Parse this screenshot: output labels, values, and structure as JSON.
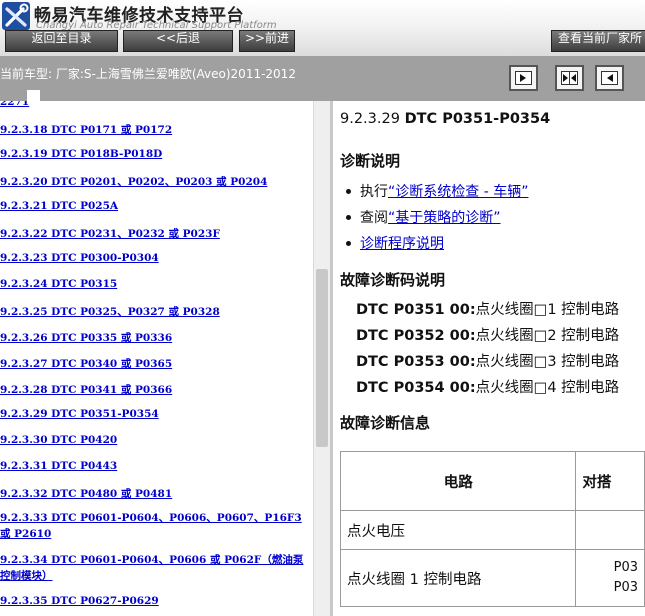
{
  "header": {
    "title": "畅易汽车维修技术支持平台",
    "subtitle": "Changyi Auto Repair Technical Support Platform",
    "buttons": {
      "back": "返回至目录",
      "prev": "<<后退",
      "next": ">>前进",
      "view": "查看当前厂家所"
    }
  },
  "vehicle_bar": {
    "label": "当前车型:   厂家:S-上海雪佛兰爱唯欧(Aveo)2011-2012"
  },
  "toc": {
    "partial_top": "2271",
    "items": [
      "9.2.3.18 DTC P0171 或 P0172",
      "9.2.3.19 DTC P018B-P018D",
      "9.2.3.20 DTC P0201、P0202、P0203 或 P0204",
      "9.2.3.21 DTC P025A",
      "9.2.3.22 DTC P0231、P0232 或 P023F",
      "9.2.3.23 DTC P0300-P0304",
      "9.2.3.24 DTC P0315",
      "9.2.3.25 DTC P0325、P0327 或 P0328",
      "9.2.3.26 DTC P0335 或 P0336",
      "9.2.3.27 DTC P0340 或 P0365",
      "9.2.3.28 DTC P0341 或 P0366",
      "9.2.3.29 DTC P0351-P0354",
      "9.2.3.30 DTC P0420",
      "9.2.3.31 DTC P0443",
      "9.2.3.32 DTC P0480 或 P0481",
      "9.2.3.33 DTC P0601-P0604、P0606、P0607、P16F3 或 P2610",
      "9.2.3.34 DTC P0601-P0604、P0606 或 P062F（燃油泵控制模块）",
      "9.2.3.35 DTC P0627-P0629"
    ]
  },
  "doc": {
    "section_num": "9.2.3.29",
    "section_title": "DTC P0351-P0354",
    "diag_heading": "诊断说明",
    "bullets": [
      {
        "prefix": "执行",
        "link": "“诊断系统检查 - 车辆”"
      },
      {
        "prefix": "查阅",
        "link": "“基于策略的诊断”"
      },
      {
        "prefix": "",
        "link": "诊断程序说明"
      }
    ],
    "dtc_heading": "故障诊断码说明",
    "dtcs": [
      {
        "code": "DTC P0351 00:",
        "desc": "点火线圈□1 控制电路"
      },
      {
        "code": "DTC P0352 00:",
        "desc": "点火线圈□2 控制电路"
      },
      {
        "code": "DTC P0353 00:",
        "desc": "点火线圈□3 控制电路"
      },
      {
        "code": "DTC P0354 00:",
        "desc": "点火线圈□4 控制电路"
      }
    ],
    "info_heading": "故障诊断信息",
    "table": {
      "headers": [
        "电路",
        "对搭"
      ],
      "rows": [
        [
          "点火电压",
          ""
        ],
        [
          "点火线圈 1 控制电路",
          "P03\nP03"
        ]
      ]
    }
  }
}
